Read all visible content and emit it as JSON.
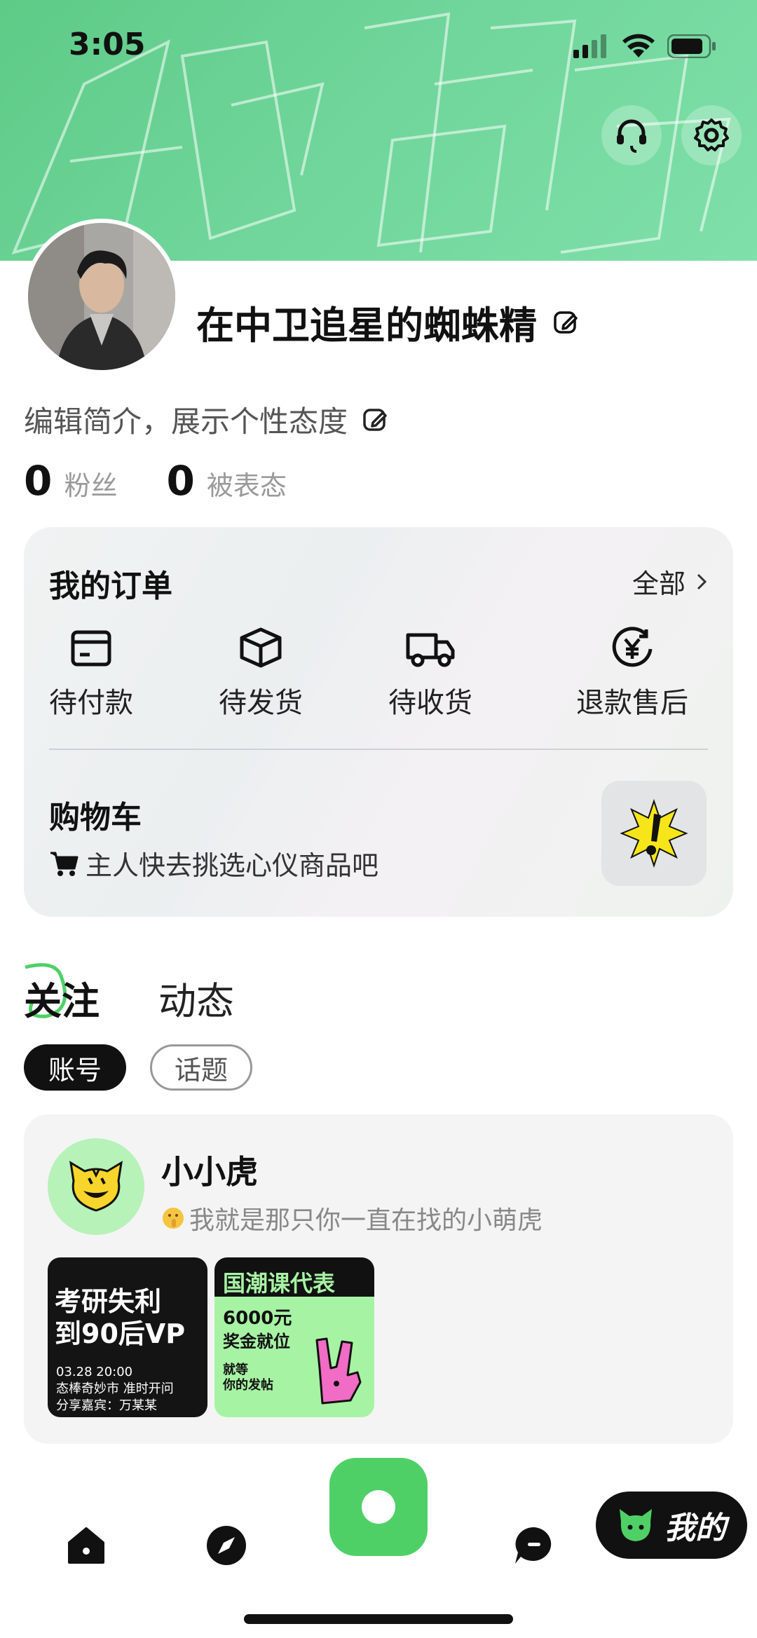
{
  "status_bar": {
    "time": "3:05"
  },
  "profile": {
    "nickname": "在中卫追星的蜘蛛精",
    "bio_placeholder": "编辑简介，展示个性态度",
    "followers_count": "0",
    "followers_label": "粉丝",
    "attitude_count": "0",
    "attitude_label": "被表态"
  },
  "orders": {
    "title": "我的订单",
    "all_label": "全部",
    "items": [
      {
        "label": "待付款",
        "icon": "card-icon"
      },
      {
        "label": "待发货",
        "icon": "box-icon"
      },
      {
        "label": "待收货",
        "icon": "truck-icon"
      },
      {
        "label": "退款售后",
        "icon": "refund-icon"
      }
    ]
  },
  "cart": {
    "title": "购物车",
    "subtitle": "主人快去挑选心仪商品吧"
  },
  "tabs": {
    "follow": "关注",
    "moments": "动态"
  },
  "pills": {
    "account": "账号",
    "topic": "话题"
  },
  "follow_card": {
    "name": "小小虎",
    "desc": "我就是那只你一直在找的小萌虎",
    "thumb1": {
      "line1": "考研失利",
      "line2": "到90后VP",
      "line3": "03.28 20:00",
      "line4": "态棒奇妙市 准时开问",
      "line5": "分享嘉宾：万某某"
    },
    "thumb2": {
      "line1": "国潮课代表",
      "line2": "6000元",
      "line3": "奖金就位",
      "line4": "就等",
      "line5": "你的发帖"
    }
  },
  "bottom_nav": {
    "mine_label": "我的"
  },
  "colors": {
    "brand_green": "#4fd067",
    "banner_green": "#6fd59a"
  }
}
